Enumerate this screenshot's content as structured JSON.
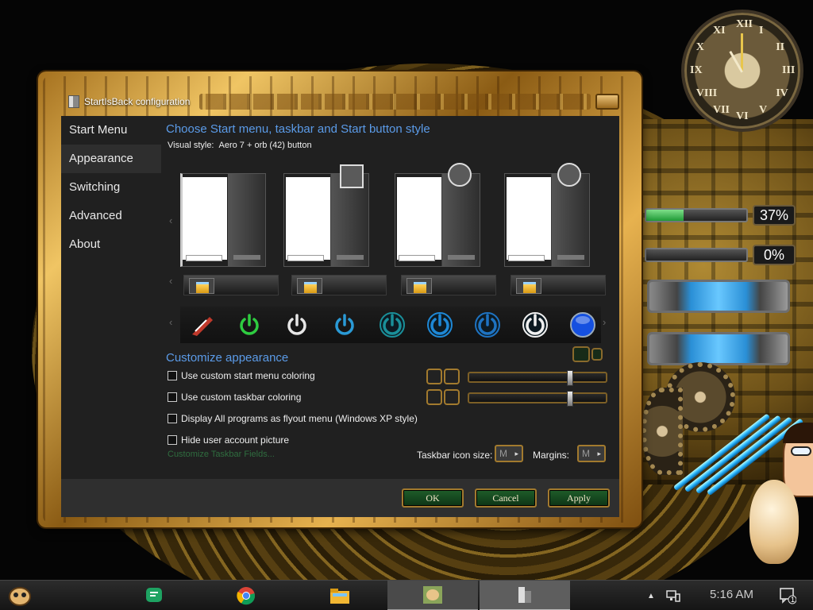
{
  "desktop": {
    "clock_numerals": [
      "XII",
      "I",
      "II",
      "III",
      "IV",
      "V",
      "VI",
      "VII",
      "VIII",
      "IX",
      "X",
      "XI"
    ],
    "meters": [
      {
        "label": "37%",
        "value": 0.37
      },
      {
        "label": "0%",
        "value": 0
      }
    ]
  },
  "window": {
    "title": "StartIsBack configuration",
    "nav": [
      "Start Menu",
      "Appearance",
      "Switching",
      "Advanced",
      "About"
    ],
    "active_nav": "Appearance",
    "section_style": "Choose Start menu, taskbar and Start button style",
    "visual_style_label": "Visual style:",
    "visual_style_value": "Aero 7 + orb (42) button",
    "section_customize": "Customize appearance",
    "checkboxes": [
      "Use custom start menu coloring",
      "Use custom taskbar coloring",
      "Display All programs as flyout menu (Windows XP style)",
      "Hide user account picture"
    ],
    "customize_link": "Customize Taskbar Fields...",
    "taskbar_icon_size_label": "Taskbar icon size:",
    "taskbar_icon_size_value": "M",
    "margins_label": "Margins:",
    "margins_value": "M",
    "buttons": {
      "ok": "OK",
      "cancel": "Cancel",
      "apply": "Apply"
    },
    "slider_levels": [
      0.75,
      0.75
    ]
  },
  "orbs": [
    {
      "name": "feather-orb-icon",
      "color": "#c0392b"
    },
    {
      "name": "green-power-icon",
      "color": "#2ecc40"
    },
    {
      "name": "white-power-icon",
      "color": "#e6e6e6"
    },
    {
      "name": "blue-power-icon",
      "color": "#2a9ad6"
    },
    {
      "name": "teal-power-icon",
      "color": "#1a8f99"
    },
    {
      "name": "dark-blue-power-icon",
      "color": "#1e88d6"
    },
    {
      "name": "blue-ring-power-icon",
      "color": "#1e73c2"
    },
    {
      "name": "white-ring-power-icon",
      "color": "#f0f0f0"
    },
    {
      "name": "blue-glass-orb-icon",
      "color": "#1550e0"
    }
  ],
  "taskbar": {
    "time": "5:16 AM",
    "notification_count": "1",
    "apps": [
      "hamster-app-icon",
      "hangouts-icon",
      "chrome-icon",
      "file-explorer-icon",
      "hamster-game-icon",
      "startisback-config-icon"
    ]
  }
}
